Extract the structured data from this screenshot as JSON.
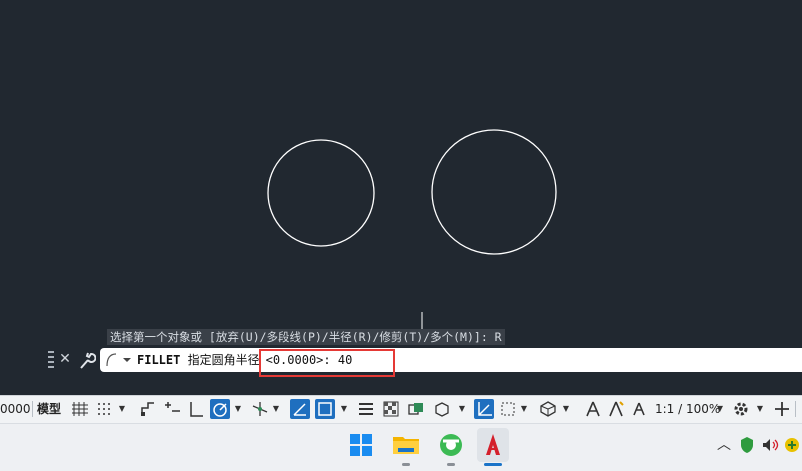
{
  "drawing": {
    "cursor": "crosshair-cursor",
    "circles": [
      {
        "name": "left-circle"
      },
      {
        "name": "right-circle"
      }
    ]
  },
  "command_history": "选择第一个对象或 [放弃(U)/多段线(P)/半径(R)/修剪(T)/多个(M)]: R",
  "command_line": {
    "command": "FILLET",
    "prompt": "指定圆角半径",
    "default_value": "<0.0000>: ",
    "entered_value": "40"
  },
  "status_bar": {
    "coords_fragment": "0000",
    "model_label": "模型",
    "annotation_scale": "1:1 / 100%",
    "icons": [
      "grid-icon",
      "snap-icon",
      "infer-constraints-icon",
      "dynamic-input-icon",
      "ortho-icon",
      "polar-tracking-icon",
      "isodraft-icon",
      "object-snap-tracking-icon",
      "object-snap-icon",
      "lineweight-icon",
      "transparency-icon",
      "selection-cycling-icon",
      "3d-osnap-icon",
      "dynamic-ucs-icon",
      "selection-filter-icon",
      "gizmo-icon",
      "annotation-visibility-icon",
      "auto-scale-icon",
      "annotation-scale-icon",
      "workspace-gear-icon",
      "customization-plus-icon",
      "customize-menu-icon"
    ]
  },
  "taskbar": {
    "apps": [
      "windows-start-icon",
      "file-explorer-icon",
      "browser-icon",
      "autocad-icon"
    ],
    "tray": [
      "chevron-up-icon",
      "security-shield-icon",
      "volume-icon",
      "app-tray-icon"
    ]
  },
  "colors": {
    "canvas_bg": "#212830",
    "circle_stroke": "#ffffff",
    "highlight_border": "#e53935",
    "active_toggle": "#1f6fbf"
  }
}
